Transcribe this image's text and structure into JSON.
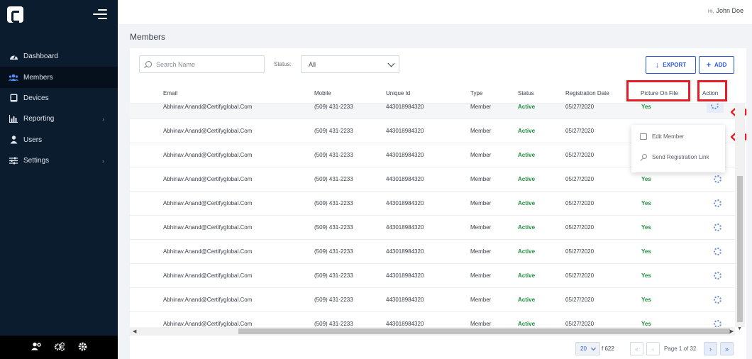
{
  "app": {
    "title": "Members"
  },
  "header": {
    "greeting_prefix": "Hi,",
    "user_name": "John Doe"
  },
  "sidebar": {
    "items": [
      {
        "label": "Dashboard",
        "icon": "dashboard-icon",
        "active": false,
        "has_submenu": false
      },
      {
        "label": "Members",
        "icon": "users-icon",
        "active": true,
        "has_submenu": false
      },
      {
        "label": "Devices",
        "icon": "tablet-icon",
        "active": false,
        "has_submenu": false
      },
      {
        "label": "Reporting",
        "icon": "bar-chart-icon",
        "active": false,
        "has_submenu": true
      },
      {
        "label": "Users",
        "icon": "user-icon",
        "active": false,
        "has_submenu": false
      },
      {
        "label": "Settings",
        "icon": "sliders-icon",
        "active": false,
        "has_submenu": true
      }
    ],
    "footer_icons": [
      "user-settings-icon",
      "cogs-icon",
      "gear-icon"
    ]
  },
  "toolbar": {
    "search_placeholder": "Search Name",
    "status_label": "Status:",
    "status_value": "All",
    "export_label": "EXPORT",
    "add_label": "ADD"
  },
  "table": {
    "columns": [
      "Email",
      "Mobile",
      "Unique Id",
      "Type",
      "Status",
      "Registration Date",
      "Picture On File",
      "Action"
    ],
    "rows": [
      {
        "email": "Abhinav.Anand@Certifyglobal.Com",
        "mobile": "(509) 431-2233",
        "unique_id": "443018984320",
        "type": "Member",
        "status": "Active",
        "date": "05/27/2020",
        "picture": "Yes"
      },
      {
        "email": "Abhinav.Anand@Certifyglobal.Com",
        "mobile": "(509) 431-2233",
        "unique_id": "443018984320",
        "type": "Member",
        "status": "Active",
        "date": "05/27/2020",
        "picture": "Yes"
      },
      {
        "email": "Abhinav.Anand@Certifyglobal.Com",
        "mobile": "(509) 431-2233",
        "unique_id": "443018984320",
        "type": "Member",
        "status": "Active",
        "date": "05/27/2020",
        "picture": "Yes"
      },
      {
        "email": "Abhinav.Anand@Certifyglobal.Com",
        "mobile": "(509) 431-2233",
        "unique_id": "443018984320",
        "type": "Member",
        "status": "Active",
        "date": "05/27/2020",
        "picture": "Yes"
      },
      {
        "email": "Abhinav.Anand@Certifyglobal.Com",
        "mobile": "(509) 431-2233",
        "unique_id": "443018984320",
        "type": "Member",
        "status": "Active",
        "date": "05/27/2020",
        "picture": "Yes"
      },
      {
        "email": "Abhinav.Anand@Certifyglobal.Com",
        "mobile": "(509) 431-2233",
        "unique_id": "443018984320",
        "type": "Member",
        "status": "Active",
        "date": "05/27/2020",
        "picture": "Yes"
      },
      {
        "email": "Abhinav.Anand@Certifyglobal.Com",
        "mobile": "(509) 431-2233",
        "unique_id": "443018984320",
        "type": "Member",
        "status": "Active",
        "date": "05/27/2020",
        "picture": "Yes"
      },
      {
        "email": "Abhinav.Anand@Certifyglobal.Com",
        "mobile": "(509) 431-2233",
        "unique_id": "443018984320",
        "type": "Member",
        "status": "Active",
        "date": "05/27/2020",
        "picture": "Yes"
      },
      {
        "email": "Abhinav.Anand@Certifyglobal.Com",
        "mobile": "(509) 431-2233",
        "unique_id": "443018984320",
        "type": "Member",
        "status": "Active",
        "date": "05/27/2020",
        "picture": "Yes"
      },
      {
        "email": "Abhinav.Anand@Certifyglobal.Com",
        "mobile": "(509) 431-2233",
        "unique_id": "443018984320",
        "type": "Member",
        "status": "Active",
        "date": "05/27/2020",
        "picture": "Yes"
      }
    ]
  },
  "action_menu": {
    "items": [
      {
        "label": "Edit Member",
        "icon": "edit-icon"
      },
      {
        "label": "Send Registration Link",
        "icon": "key-icon"
      }
    ]
  },
  "pagination": {
    "page_size": "20",
    "total_text": "f 622",
    "page_text": "Page 1 of 32"
  },
  "colors": {
    "sidebar_bg": "#0b1c2e",
    "accent": "#2a5bd7",
    "status_green": "#1e8e3e",
    "highlight_red": "#e81c24"
  }
}
